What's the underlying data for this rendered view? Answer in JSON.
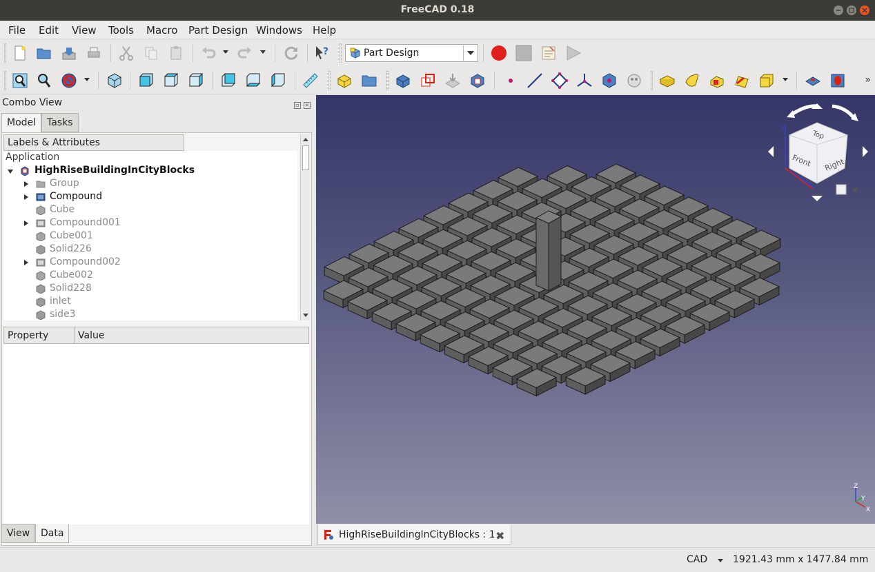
{
  "window": {
    "title": "FreeCAD 0.18"
  },
  "menu": [
    "File",
    "Edit",
    "View",
    "Tools",
    "Macro",
    "Part Design",
    "Windows",
    "Help"
  ],
  "toolbar": {
    "workbench": "Part Design",
    "more": "»"
  },
  "combo_view": {
    "title": "Combo View",
    "tabs": [
      "Model",
      "Tasks"
    ],
    "active_tab": "Model",
    "tree_header": "Labels & Attributes",
    "tree_root": "Application",
    "document": "HighRiseBuildingInCityBlocks",
    "items": [
      {
        "label": "Group",
        "expandable": true,
        "style": "dim",
        "icon": "folder-icon"
      },
      {
        "label": "Compound",
        "expandable": true,
        "style": "normal",
        "icon": "compound-icon"
      },
      {
        "label": "Cube",
        "expandable": false,
        "style": "dim",
        "icon": "cube-icon"
      },
      {
        "label": "Compound001",
        "expandable": true,
        "style": "dim",
        "icon": "compound-icon"
      },
      {
        "label": "Cube001",
        "expandable": false,
        "style": "dim",
        "icon": "cube-icon"
      },
      {
        "label": "Solid226",
        "expandable": false,
        "style": "dim",
        "icon": "solid-icon"
      },
      {
        "label": "Compound002",
        "expandable": true,
        "style": "dim",
        "icon": "compound-icon"
      },
      {
        "label": "Cube002",
        "expandable": false,
        "style": "dim",
        "icon": "cube-icon"
      },
      {
        "label": "Solid228",
        "expandable": false,
        "style": "dim",
        "icon": "solid-icon"
      },
      {
        "label": "inlet",
        "expandable": false,
        "style": "dim",
        "icon": "solid-icon"
      },
      {
        "label": "side3",
        "expandable": false,
        "style": "dim",
        "icon": "solid-icon"
      }
    ],
    "property_headers": [
      "Property",
      "Value"
    ],
    "bottom_tabs": [
      "View",
      "Data"
    ],
    "active_bottom_tab": "Data"
  },
  "navcube": {
    "top": "Top",
    "front": "Front",
    "right": "Right"
  },
  "axes": {
    "x": "X",
    "y": "Y",
    "z": "Z"
  },
  "document_tab": {
    "label": "HighRiseBuildingInCityBlocks : 1"
  },
  "status": {
    "navigation": "CAD",
    "dimensions": "1921.43 mm x 1477.84 mm"
  },
  "colors": {
    "title_bar": "#3b3b37",
    "close_button": "#e95420",
    "block_fill": "#7a7a7a",
    "view_top": "#353568",
    "view_bottom": "#8e8fa8",
    "macro_record": "#e0201c"
  }
}
